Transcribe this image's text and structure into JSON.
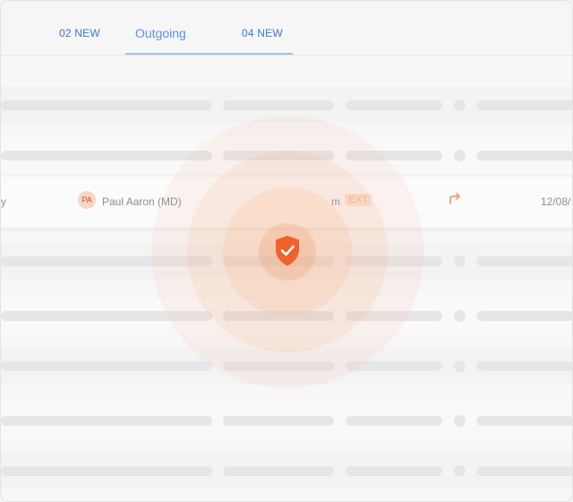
{
  "tabs": [
    {
      "badge": "02 NEW"
    },
    {
      "label": "Outgoing",
      "badge": "04 NEW"
    }
  ],
  "highlighted_row": {
    "subject_tail": "y",
    "avatar_initials": "PA",
    "sender": "Paul Aaron (MD)",
    "time_tail": "m",
    "tag": "EXT",
    "date": "12/08/"
  },
  "colors": {
    "accent": "#3b78d8",
    "shield": "#f0612b",
    "glow": "#f7a571"
  },
  "icons": {
    "forward": "forward-arrow-icon",
    "shield": "shield-check-icon"
  }
}
